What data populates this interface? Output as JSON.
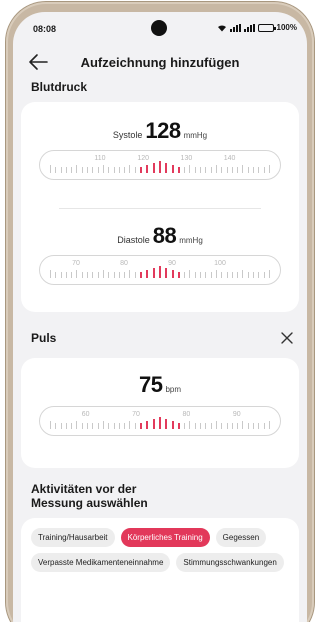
{
  "status_bar": {
    "time": "08:08",
    "battery": "100%"
  },
  "header": {
    "title": "Aufzeichnung hinzufügen"
  },
  "blood_pressure": {
    "section_title": "Blutdruck",
    "systole": {
      "label": "Systole",
      "value": "128",
      "unit": "mmHg",
      "scale": [
        "110",
        "120",
        "130",
        "140"
      ]
    },
    "diastole": {
      "label": "Diastole",
      "value": "88",
      "unit": "mmHg",
      "scale": [
        "70",
        "80",
        "90",
        "100"
      ]
    }
  },
  "pulse": {
    "section_title": "Puls",
    "value": "75",
    "unit": "bpm",
    "scale": [
      "60",
      "70",
      "80",
      "90"
    ]
  },
  "activities": {
    "section_title": "Aktivitäten vor der Messung auswählen",
    "chips": [
      {
        "label": "Training/Hausarbeit",
        "selected": false
      },
      {
        "label": "Körperliches Training",
        "selected": true
      },
      {
        "label": "Gegessen",
        "selected": false
      },
      {
        "label": "Verpasste Medikamenteneinnahme",
        "selected": false
      },
      {
        "label": "Stimmungsschwankungen",
        "selected": false
      }
    ]
  },
  "colors": {
    "accent": "#e2385a",
    "background": "#f2f2f4",
    "card": "#ffffff"
  },
  "icons": {
    "back": "back-arrow-icon",
    "close": "close-icon",
    "wifi": "wifi-icon",
    "signal": "signal-icon",
    "battery": "battery-icon"
  }
}
